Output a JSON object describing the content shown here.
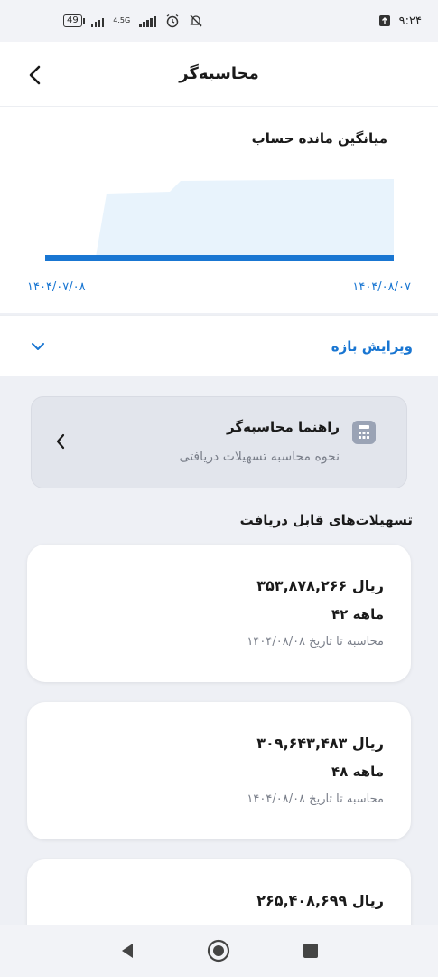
{
  "status": {
    "time": "۹:۲۴",
    "battery": "49",
    "network": "4.5G"
  },
  "header": {
    "title": "محاسبه‌گر"
  },
  "chart": {
    "title": "میانگین مانده حساب",
    "date_start": "۱۴۰۴/۰۷/۰۸",
    "date_end": "۱۴۰۴/۰۸/۰۷",
    "line_color": "#1976d2",
    "area_color": "#e8f3fc"
  },
  "chart_data": {
    "type": "area",
    "x": [
      "۱۴۰۴/۰۷/۰۸",
      "۱۴۰۴/۰۸/۰۷"
    ],
    "title": "میانگین مانده حساب",
    "xlabel": "",
    "ylabel": "",
    "grid": false
  },
  "edit": {
    "label": "ویرایش بازه"
  },
  "guide": {
    "title": "راهنما محاسبه‌گر",
    "subtitle": "نحوه محاسبه تسهیلات دریافتی"
  },
  "section": {
    "title": "تسهیلات‌های قابل دریافت"
  },
  "loans": [
    {
      "amount": "۳۵۳,۸۷۸,۲۶۶ ریال",
      "term": "۴۲ ماهه",
      "note": "محاسبه تا تاریخ ۱۴۰۴/۰۸/۰۸"
    },
    {
      "amount": "۳۰۹,۶۴۳,۴۸۳ ریال",
      "term": "۴۸ ماهه",
      "note": "محاسبه تا تاریخ ۱۴۰۴/۰۸/۰۸"
    },
    {
      "amount": "۲۶۵,۴۰۸,۶۹۹ ریال",
      "term": "",
      "note": ""
    }
  ],
  "colors": {
    "accent": "#1976d2",
    "background": "#eef0f5"
  }
}
